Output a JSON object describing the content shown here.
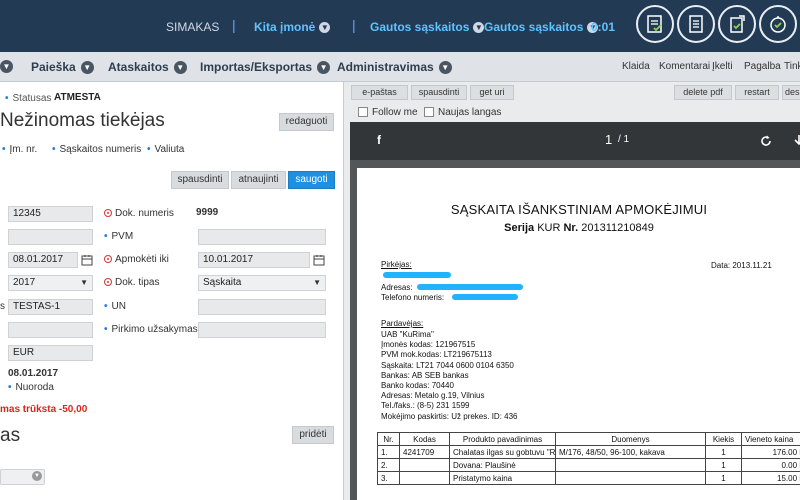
{
  "header": {
    "user": "SIMAKAS",
    "company": "Kita įmonė",
    "selector1": "Gautos sąskaitos",
    "selector2": "Gautos sąskaitos",
    "timer": "0:01"
  },
  "nav": {
    "items": [
      "Paieška",
      "Ataskaitos",
      "Importas/Eksportas",
      "Administravimas"
    ],
    "links": [
      "Klaida",
      "Komentarai",
      "Įkelti",
      "Pagalba",
      "Tinkl"
    ]
  },
  "left": {
    "status_label": "Statusas",
    "status_value": "ATMESTA",
    "supplier": "Nežinomas tiekėjas",
    "edit_button": "redaguoti",
    "chips": [
      "Įm. nr.",
      "Sąskaitos numeris",
      "Valiuta"
    ],
    "print_button": "spausdinti",
    "refresh_button": "atnaujinti",
    "save_button": "saugoti",
    "fields": {
      "left1": "12345",
      "doc_number_label": "Dok. numeris",
      "doc_number_value": "9999",
      "left2": "",
      "pvm_label": "PVM",
      "pvm_value": "",
      "date": "08.01.2017",
      "due_label": "Apmokėti iki",
      "due_value": "10.01.2017",
      "year": "2017",
      "doc_type_label": "Dok. tipas",
      "doc_type_value": "Sąskaita",
      "side_s": "s",
      "testas": "TESTAS-1",
      "un_label": "UN",
      "un_value": "",
      "left5": "",
      "order_label": "Pirkimo užsakymas",
      "order_value": "",
      "currency": "EUR",
      "date2": "08.01.2017",
      "nuoroda": "Nuoroda"
    },
    "warning": "mas trūksta -50,00",
    "section_title": "as",
    "add_button": "pridėti"
  },
  "right": {
    "buttons": [
      "e-paštas",
      "spausdinti",
      "get uri"
    ],
    "right_buttons": [
      "delete pdf",
      "restart",
      "desk"
    ],
    "follow_me": "Follow me",
    "new_window": "Naujas langas",
    "viewer": {
      "menu_glyph": "f",
      "page_current": "1",
      "page_total": "/ 1"
    },
    "document": {
      "title": "SĄSKAITA IŠANKSTINIAM APMOKĖJIMUI",
      "series_label": "Serija",
      "series_value": "KUR",
      "number_label": "Nr.",
      "number_value": "201311210849",
      "buyer_label": "Pirkėjas:",
      "date_line": "Data: 2013.11.21",
      "address_label": "Adresas:",
      "phone_label": "Telefono numeris:",
      "seller_label": "Pardavėjas:",
      "seller_lines": [
        "UAB \"KuRima\"",
        "Įmonės kodas: 121967515",
        "PVM mok.kodas: LT219675113",
        "Sąskaita: LT21 7044 0600 0104 6350",
        "Bankas: AB SEB bankas",
        "Banko kodas: 70440",
        "Adresas: Metalo g.19, Vilnius",
        "Tel./faks.: (8-5) 231 1599",
        "Mokėjimo paskirtis: Už prekes. ID: 436"
      ],
      "table_headers": [
        "Nr.",
        "Kodas",
        "Produkto pavadinimas",
        "Duomenys",
        "Kiekis",
        "Vieneto kaina"
      ],
      "table_rows": [
        [
          "1.",
          "4241709",
          "Chalatas ilgas su gobtuvu \"R",
          "M/176, 48/50, 96-100, kakava",
          "1",
          "176.00 LT"
        ],
        [
          "2.",
          "",
          "Dovana: Plaušinė",
          "",
          "1",
          "0.00 LT"
        ],
        [
          "3.",
          "",
          "Pristatymo kaina",
          "",
          "1",
          "15.00 LT"
        ]
      ]
    }
  }
}
